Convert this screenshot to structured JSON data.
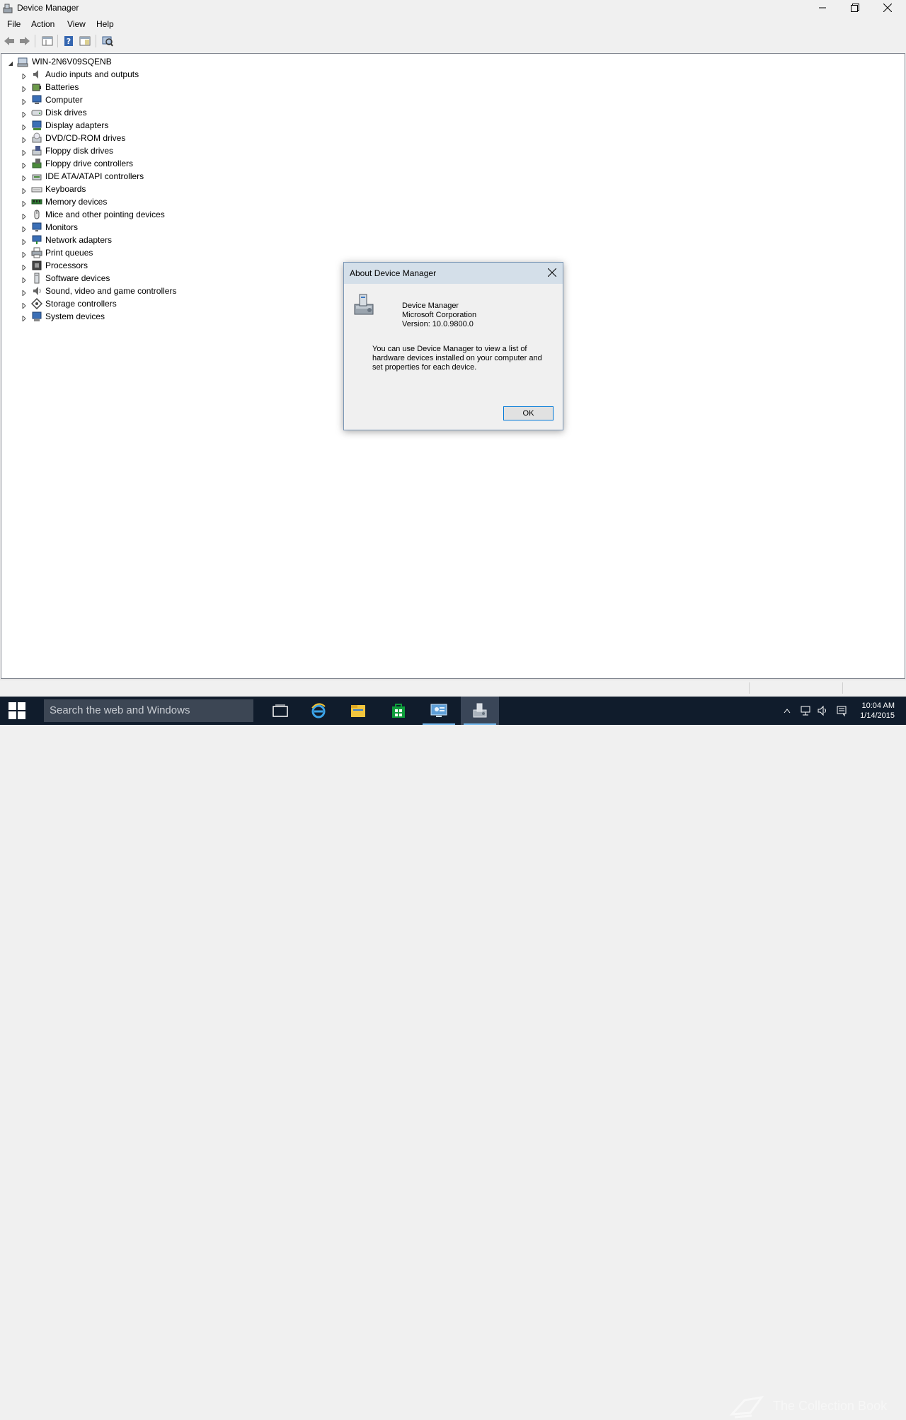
{
  "window": {
    "title": "Device Manager"
  },
  "menu": [
    "File",
    "Action",
    "View",
    "Help"
  ],
  "toolbar": {
    "icons": [
      "back-arrow-icon",
      "forward-arrow-icon",
      "properties-icon",
      "help-icon",
      "show-hide-icon",
      "scan-hardware-icon"
    ]
  },
  "tree": {
    "root": "WIN-2N6V09SQENB",
    "items": [
      {
        "label": "Audio inputs and outputs",
        "icon": "speaker-icon"
      },
      {
        "label": "Batteries",
        "icon": "battery-icon"
      },
      {
        "label": "Computer",
        "icon": "computer-icon"
      },
      {
        "label": "Disk drives",
        "icon": "disk-drive-icon"
      },
      {
        "label": "Display adapters",
        "icon": "display-adapter-icon"
      },
      {
        "label": "DVD/CD-ROM drives",
        "icon": "dvd-drive-icon"
      },
      {
        "label": "Floppy disk drives",
        "icon": "floppy-disk-icon"
      },
      {
        "label": "Floppy drive controllers",
        "icon": "floppy-controller-icon"
      },
      {
        "label": "IDE ATA/ATAPI controllers",
        "icon": "ide-controller-icon"
      },
      {
        "label": "Keyboards",
        "icon": "keyboard-icon"
      },
      {
        "label": "Memory devices",
        "icon": "memory-icon"
      },
      {
        "label": "Mice and other pointing devices",
        "icon": "mouse-icon"
      },
      {
        "label": "Monitors",
        "icon": "monitor-icon"
      },
      {
        "label": "Network adapters",
        "icon": "network-adapter-icon"
      },
      {
        "label": "Print queues",
        "icon": "printer-icon"
      },
      {
        "label": "Processors",
        "icon": "processor-icon"
      },
      {
        "label": "Software devices",
        "icon": "software-device-icon"
      },
      {
        "label": "Sound, video and game controllers",
        "icon": "sound-icon"
      },
      {
        "label": "Storage controllers",
        "icon": "storage-controller-icon"
      },
      {
        "label": "System devices",
        "icon": "system-device-icon"
      }
    ]
  },
  "dialog": {
    "title": "About Device Manager",
    "app_name": "Device Manager",
    "company": "Microsoft Corporation",
    "version": "Version: 10.0.9800.0",
    "description": "You can use Device Manager to view a list of hardware devices installed on your computer and set properties for each device.",
    "ok_label": "OK"
  },
  "taskbar": {
    "search_placeholder": "Search the web and Windows",
    "apps": [
      "task-view-icon",
      "internet-explorer-icon",
      "file-explorer-icon",
      "store-icon",
      "control-panel-icon",
      "device-manager-icon"
    ],
    "time": "10:04 AM",
    "date": "1/14/2015",
    "watermark": "The Collection Book"
  },
  "colors": {
    "taskbar": "#101c2c",
    "dialog_title": "#d4dfe9",
    "accent": "#0078d7"
  }
}
